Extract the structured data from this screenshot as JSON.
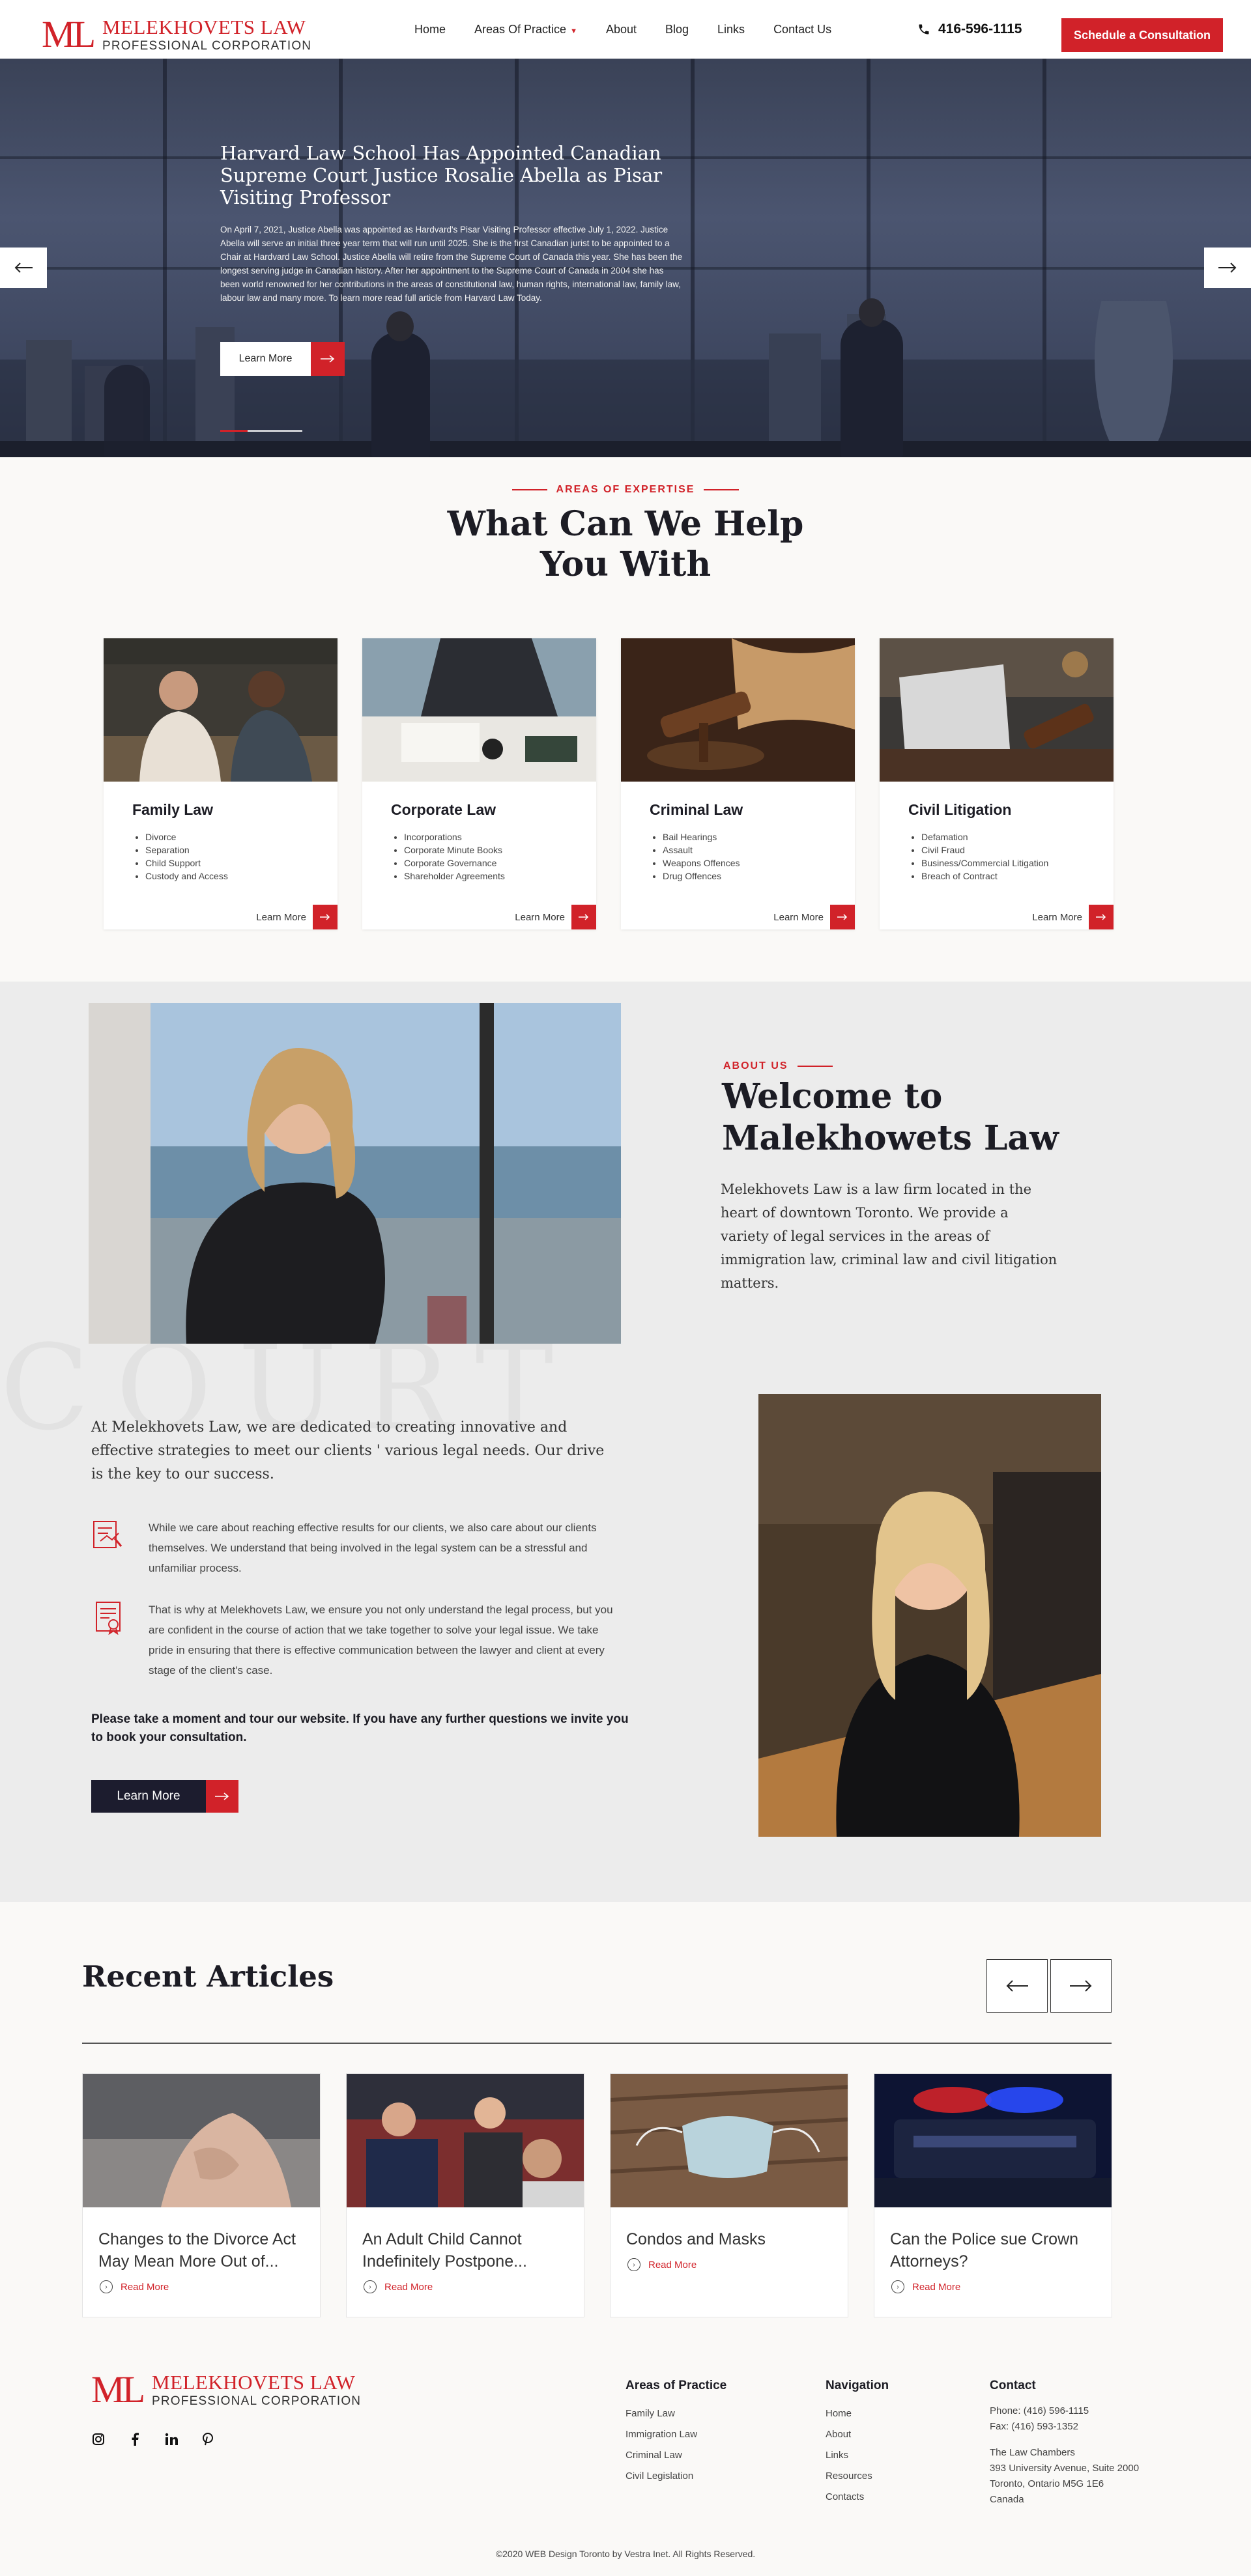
{
  "brand": {
    "mark": "ML",
    "name": "MELEKHOVETS LAW",
    "subtitle": "PROFESSIONAL CORPORATION",
    "accent_color": "#d12229",
    "dark_color": "#1c1c2e"
  },
  "nav": {
    "items": [
      "Home",
      "Areas Of Practice",
      "About",
      "Blog",
      "Links",
      "Contact Us"
    ],
    "dropdown_index": 1
  },
  "phone": "416-596-1115",
  "cta_button": "Schedule a Consultation",
  "hero": {
    "title": "Harvard Law School Has Appointed Canadian Supreme Court Justice Rosalie Abella as Pisar Visiting Professor",
    "body": "On April 7, 2021, Justice Abella was appointed as Hardvard's Pisar Visiting Professor effective July 1, 2022. Justice Abella will serve an initial three year term that will run until 2025. She is the first Canadian jurist to be appointed to a Chair at Hardvard Law School. Justice Abella will retire from the Supreme Court of Canada this year. She has been the longest serving judge in Canadian history. After her appointment to the Supreme Court of Canada in 2004 she has been world renowned for her contributions in the areas of constitutional law, human rights, international law, family law, labour law and many more. To learn more read full article from Harvard Law Today.",
    "button": "Learn More",
    "slides": 3,
    "active_slide": 1,
    "prev_icon": "arrow-left-icon",
    "next_icon": "arrow-right-icon"
  },
  "expertise": {
    "eyebrow": "AREAS OF EXPERTISE",
    "title_line1": "What Can We Help",
    "title_line2": "You With",
    "cards": [
      {
        "title": "Family Law",
        "items": [
          "Divorce",
          "Separation",
          "Child Support",
          "Custody and Access"
        ],
        "link": "Learn More"
      },
      {
        "title": "Corporate Law",
        "items": [
          "Incorporations",
          "Corporate Minute Books",
          "Corporate Governance",
          "Shareholder Agreements"
        ],
        "link": "Learn More"
      },
      {
        "title": "Criminal Law",
        "items": [
          "Bail Hearings",
          "Assault",
          "Weapons Offences",
          "Drug Offences"
        ],
        "link": "Learn More"
      },
      {
        "title": "Civil Litigation",
        "items": [
          "Defamation",
          "Civil Fraud",
          "Business/Commercial Litigation",
          "Breach of Contract"
        ],
        "link": "Learn More"
      }
    ]
  },
  "about": {
    "eyebrow": "ABOUT US",
    "title_line1": "Welcome to",
    "title_line2": "Malekhowets Law",
    "lead": "Melekhovets Law is a law firm located in the heart of downtown Toronto. We provide a variety of legal services in the areas of immigration law, criminal law and civil litigation matters.",
    "intro": "At Melekhovets Law, we are dedicated to creating innovative and effective strategies to meet our clients ' various legal needs. Our drive is the key to our success.",
    "feature1": "While we care about reaching effective results for our clients, we also care about our clients themselves. We understand that being involved in the legal system can be a stressful and unfamiliar process.",
    "feature2": "That is why at Melekhovets Law, we ensure you not only understand the legal process, but you are confident in the course of action that we take together to solve your legal issue. We take pride in ensuring that there is effective communication between the lawyer and client at every stage of the client's case.",
    "cta_text": "Please take a moment and tour our website. If you have any further questions we invite you to book your consultation.",
    "button": "Learn More"
  },
  "articles": {
    "title": "Recent Articles",
    "items": [
      {
        "title": "Changes to the Divorce Act May Mean More Out of...",
        "link": "Read More"
      },
      {
        "title": "An Adult Child Cannot Indefinitely Postpone...",
        "link": "Read More"
      },
      {
        "title": "Condos and Masks",
        "link": "Read More"
      },
      {
        "title": "Can the Police sue Crown Attorneys?",
        "link": "Read More"
      }
    ]
  },
  "footer": {
    "social": [
      "instagram-icon",
      "facebook-icon",
      "linkedin-icon",
      "pinterest-icon"
    ],
    "practice": {
      "title": "Areas of Practice",
      "items": [
        "Family Law",
        "Immigration Law",
        "Criminal Law",
        "Civil Legislation"
      ]
    },
    "navigation": {
      "title": "Navigation",
      "items": [
        "Home",
        "About",
        "Links",
        "Resources",
        "Contacts"
      ]
    },
    "contact": {
      "title": "Contact",
      "phone": "Phone: (416) 596-1115",
      "fax": "Fax: (416) 593-1352",
      "addr1": "The Law Chambers",
      "addr2": "393 University Avenue, Suite 2000",
      "addr3": "Toronto, Ontario M5G 1E6",
      "addr4": "Canada"
    },
    "copyright": "©2020 WEB Design Toronto by Vestra Inet. All Rights Reserved."
  }
}
